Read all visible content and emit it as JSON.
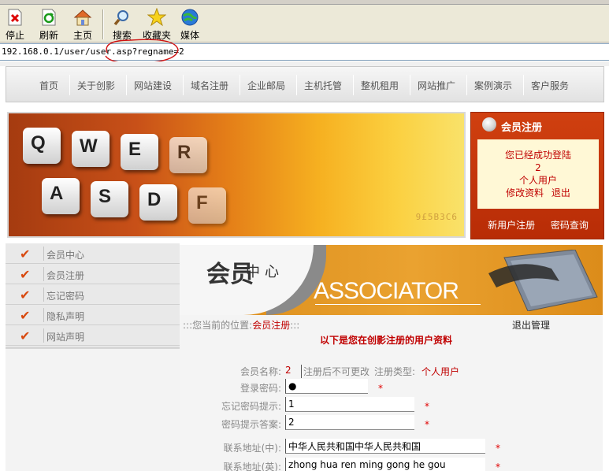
{
  "browser": {
    "toolbar": [
      {
        "name": "stop",
        "label": "停止",
        "icon": "stop-icon"
      },
      {
        "name": "refresh",
        "label": "刷新",
        "icon": "refresh-icon"
      },
      {
        "name": "home",
        "label": "主页",
        "icon": "home-icon"
      },
      {
        "name": "search",
        "label": "搜索",
        "icon": "search-icon"
      },
      {
        "name": "favorites",
        "label": "收藏夹",
        "icon": "star-icon"
      },
      {
        "name": "media",
        "label": "媒体",
        "icon": "media-icon"
      }
    ],
    "address": "192.168.0.1/user/user.asp?regname=2"
  },
  "nav": {
    "items": [
      "首页",
      "关于创影",
      "网站建设",
      "域名注册",
      "企业邮局",
      "主机托管",
      "整机租用",
      "网站推广",
      "案例演示",
      "客户服务"
    ]
  },
  "banner": {
    "keys": [
      "Q",
      "W",
      "E",
      "R",
      "A",
      "S",
      "D",
      "F"
    ],
    "code": "9£5B3C6"
  },
  "member_box": {
    "title": "会员注册",
    "lines": [
      "您已经成功登陆",
      "2",
      "个人用户"
    ],
    "edit_link": "修改资料",
    "logout_link": "退出",
    "register_link": "新用户注册",
    "password_link": "密码查询"
  },
  "sidemenu": {
    "items": [
      "会员中心",
      "会员注册",
      "忘记密码",
      "隐私声明",
      "网站声明"
    ]
  },
  "header": {
    "cn_big": "会员",
    "cn_small": "中心",
    "en": "ASSOCIATOR"
  },
  "content": {
    "breadcrumb_prefix": ":::您当前的位置:",
    "breadcrumb_current": "会员注册",
    "breadcrumb_suffix": ":::",
    "logout": "退出管理",
    "title": "以下是您在创影注册的用户资料",
    "fields": {
      "member_name_label": "会员名称:",
      "member_name_value": "2",
      "member_name_note": "注册后不可更改",
      "user_type_label": "注册类型:",
      "user_type_value": "个人用户",
      "password_label": "登录密码:",
      "password_value": "●",
      "hint_label": "忘记密码提示:",
      "hint_value": "1",
      "answer_label": "密码提示答案:",
      "answer_value": "2",
      "addr_cn_label": "联系地址(中):",
      "addr_cn_value": "中华人民共和国中华人民共和国",
      "addr_en_label": "联系地址(英):",
      "addr_en_value": "zhong hua ren ming gong he gou",
      "required_mark": "*"
    }
  }
}
